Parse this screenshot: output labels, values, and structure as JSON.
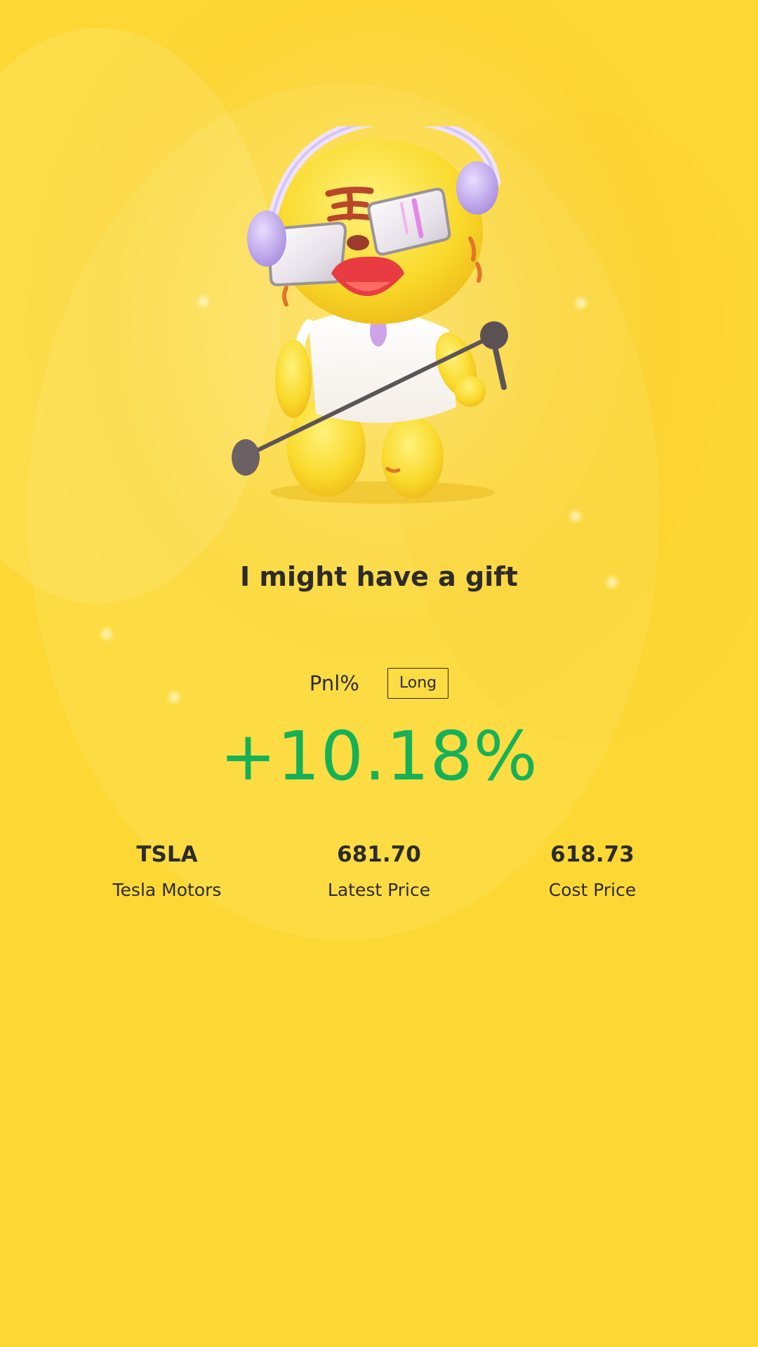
{
  "gift": {
    "headline": "I might have a gift"
  },
  "pnl": {
    "label": "Pnl%",
    "direction": "Long",
    "value": "+10.18%",
    "color": "#16b157"
  },
  "stock": {
    "symbol": "TSLA",
    "name": "Tesla Motors",
    "latest_price": "681.70",
    "latest_price_label": "Latest Price",
    "cost_price": "618.73",
    "cost_price_label": "Cost Price"
  },
  "colors": {
    "background": "#fdd835",
    "text": "#2c2b2a"
  },
  "icons": {
    "mascot": "tiger-mascot-singer"
  }
}
